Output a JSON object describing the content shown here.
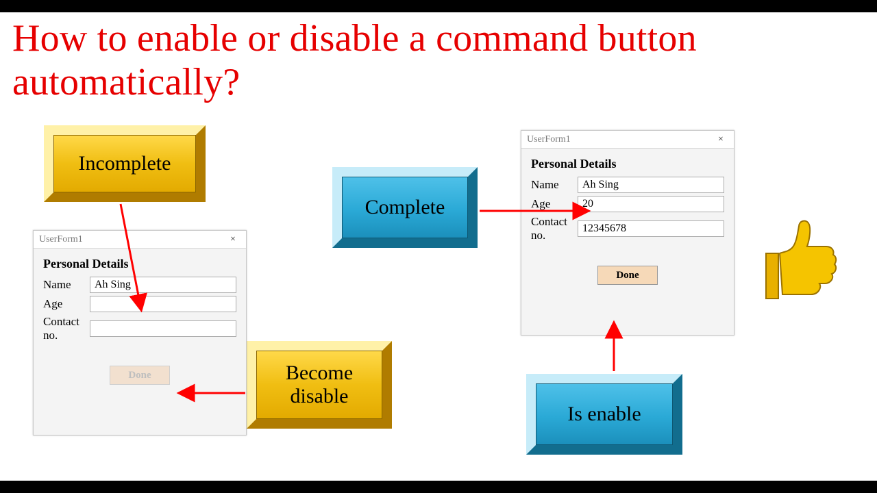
{
  "title": "How to enable or disable a command button automatically?",
  "panels": {
    "incomplete": "Incomplete",
    "complete": "Complete",
    "become_disable": "Become disable",
    "is_enable": "Is enable"
  },
  "form_left": {
    "window_title": "UserForm1",
    "heading": "Personal Details",
    "name_label": "Name",
    "age_label": "Age",
    "contact_label": "Contact no.",
    "name_value": "Ah Sing",
    "age_value": "",
    "contact_value": "",
    "button_label": "Done",
    "button_enabled": false
  },
  "form_right": {
    "window_title": "UserForm1",
    "heading": "Personal Details",
    "name_label": "Name",
    "age_label": "Age",
    "contact_label": "Contact no.",
    "name_value": "Ah Sing",
    "age_value": "20",
    "contact_value": "12345678",
    "button_label": "Done",
    "button_enabled": true
  },
  "colors": {
    "title": "#e60000",
    "gold": "#f0be12",
    "blue": "#2aa9d6",
    "arrow": "#ff0000"
  }
}
